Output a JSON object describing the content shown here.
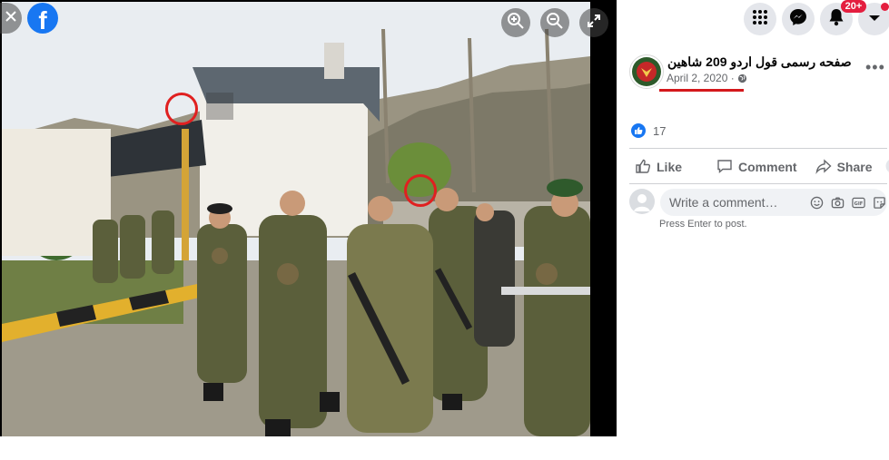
{
  "viewer": {
    "logo_letter": "f",
    "buttons": [
      "close-icon",
      "zoom-in-icon",
      "zoom-out-icon",
      "fullscreen-icon"
    ]
  },
  "topbar": {
    "icons": [
      "grid-menu-icon",
      "messenger-icon",
      "bell-icon",
      "chevron-down-icon"
    ],
    "notification_badge": "20+"
  },
  "post": {
    "page_name": "صفحه رسمی قول اردو 209 شاهین",
    "date": "April 2, 2020",
    "date_separator": "·",
    "privacy_icon": "globe-icon",
    "more_label": "•••",
    "reaction_count": "17",
    "actions": {
      "like": "Like",
      "comment": "Comment",
      "share": "Share"
    },
    "comment_placeholder": "Write a comment…",
    "comment_hint": "Press Enter to post.",
    "comment_icons": [
      "smile-icon",
      "camera-icon",
      "gif-icon",
      "sticker-icon"
    ]
  },
  "colors": {
    "facebook_blue": "#1877f2",
    "annotation_red": "#e02020",
    "badge_red": "#e41e3f",
    "secondary_text": "#65676b"
  }
}
